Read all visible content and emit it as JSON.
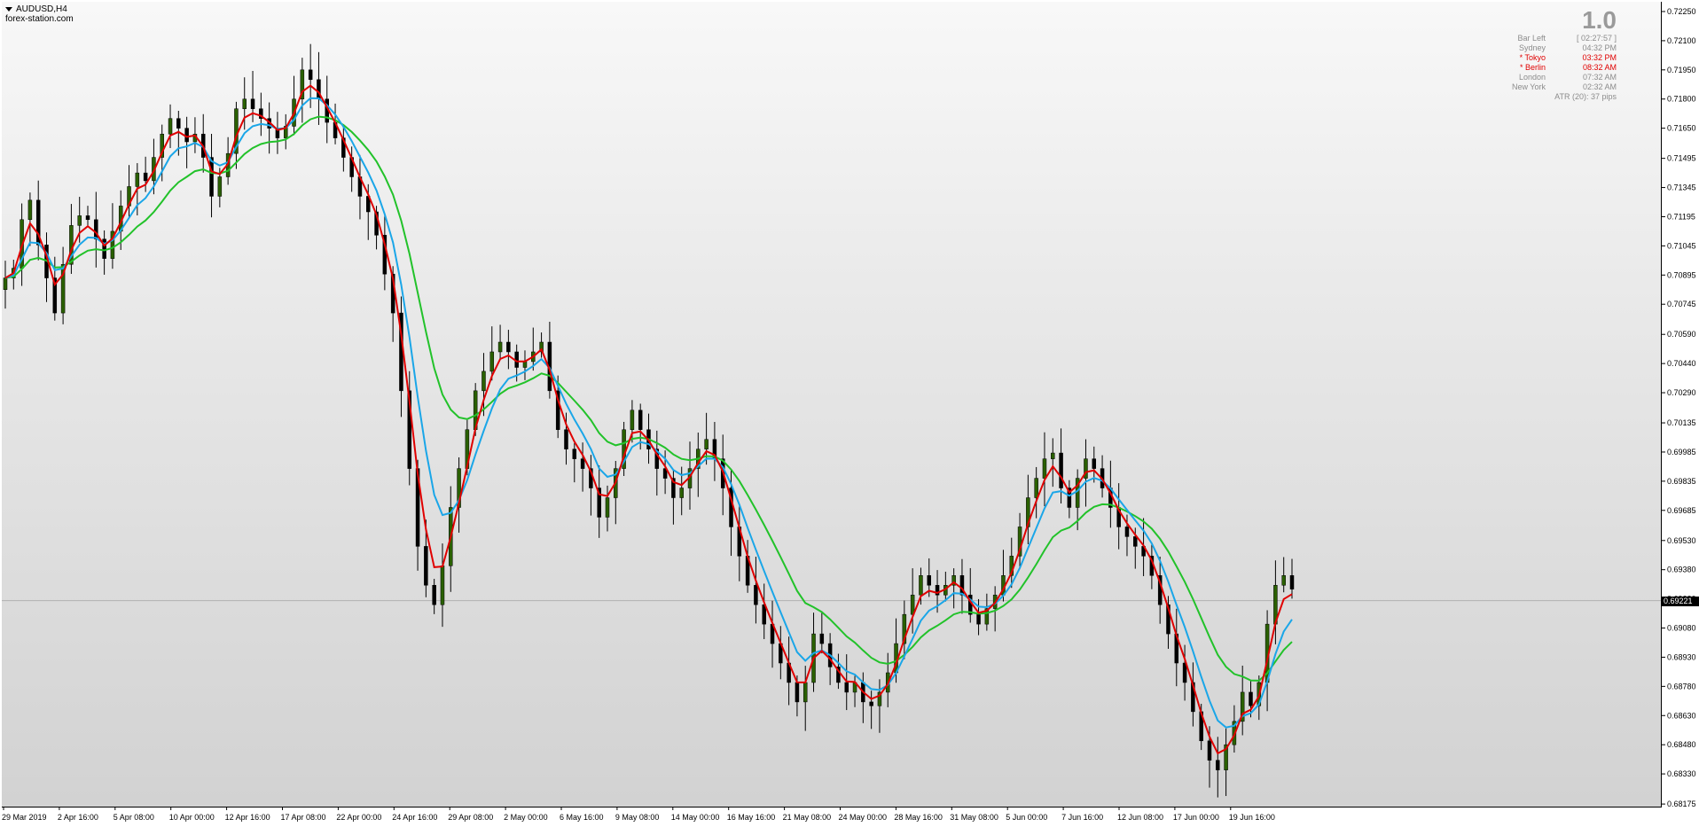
{
  "window": {
    "title": "AUDUSD,H4",
    "subtitle": "forex-station.com"
  },
  "info_panel": {
    "big_value": "1.0",
    "rows": [
      {
        "label": "Bar Left",
        "value": "[ 02:27:57 ]",
        "highlight": false
      },
      {
        "label": "Sydney",
        "value": "04:32 PM",
        "highlight": false
      },
      {
        "label": "* Tokyo",
        "value": "03:32 PM",
        "highlight": true
      },
      {
        "label": "* Berlin",
        "value": "08:32 AM",
        "highlight": true
      },
      {
        "label": "London",
        "value": "07:32 AM",
        "highlight": false
      },
      {
        "label": "New York",
        "value": "02:32 AM",
        "highlight": false
      }
    ],
    "atr": "ATR (20): 37 pips"
  },
  "current_price": "0.69221",
  "colors": {
    "bull_candle": "#2a6000",
    "bear_candle": "#000000",
    "wick": "#000000",
    "red_line": "#e00000",
    "blue_line": "#1aa6e8",
    "green_line": "#22c22a",
    "current_line": "#b0b0b0"
  },
  "chart_data": {
    "type": "line",
    "symbol": "AUDUSD",
    "timeframe": "H4",
    "ylim": [
      0.6818,
      0.7225
    ],
    "y_ticks": [
      "0.72250",
      "0.72100",
      "0.71950",
      "0.71800",
      "0.71650",
      "0.71495",
      "0.71345",
      "0.71195",
      "0.71045",
      "0.70895",
      "0.70745",
      "0.70590",
      "0.70440",
      "0.70290",
      "0.70135",
      "0.69985",
      "0.69835",
      "0.69685",
      "0.69530",
      "0.69380",
      "0.69230",
      "0.69080",
      "0.68930",
      "0.68780",
      "0.68630",
      "0.68480",
      "0.68330",
      "0.68175"
    ],
    "x_ticks": [
      "29 Mar 2019",
      "2 Apr 16:00",
      "5 Apr 08:00",
      "10 Apr 00:00",
      "12 Apr 16:00",
      "17 Apr 08:00",
      "22 Apr 00:00",
      "24 Apr 16:00",
      "29 Apr 08:00",
      "2 May 00:00",
      "6 May 16:00",
      "9 May 08:00",
      "14 May 00:00",
      "16 May 16:00",
      "21 May 08:00",
      "24 May 00:00",
      "28 May 16:00",
      "31 May 08:00",
      "5 Jun 00:00",
      "7 Jun 16:00",
      "12 Jun 08:00",
      "17 Jun 00:00",
      "19 Jun 16:00"
    ],
    "grid": false,
    "price_close": [
      0.7088,
      0.7093,
      0.7118,
      0.7128,
      0.7105,
      0.7088,
      0.707,
      0.7095,
      0.7115,
      0.712,
      0.7118,
      0.7108,
      0.7098,
      0.7112,
      0.7125,
      0.7135,
      0.7142,
      0.7138,
      0.715,
      0.7162,
      0.717,
      0.7165,
      0.7158,
      0.7162,
      0.715,
      0.713,
      0.714,
      0.7152,
      0.7175,
      0.718,
      0.7175,
      0.717,
      0.7165,
      0.716,
      0.7166,
      0.718,
      0.7195,
      0.719,
      0.718,
      0.7168,
      0.716,
      0.715,
      0.714,
      0.713,
      0.7122,
      0.711,
      0.709,
      0.707,
      0.703,
      0.699,
      0.695,
      0.693,
      0.692,
      0.694,
      0.697,
      0.699,
      0.701,
      0.703,
      0.704,
      0.705,
      0.7055,
      0.705,
      0.7042,
      0.7045,
      0.705,
      0.7055,
      0.703,
      0.701,
      0.7,
      0.6995,
      0.699,
      0.698,
      0.6965,
      0.6975,
      0.699,
      0.701,
      0.702,
      0.701,
      0.7,
      0.699,
      0.6985,
      0.6975,
      0.698,
      0.699,
      0.7,
      0.7005,
      0.6995,
      0.698,
      0.696,
      0.6945,
      0.693,
      0.692,
      0.691,
      0.69,
      0.689,
      0.688,
      0.687,
      0.688,
      0.6905,
      0.69,
      0.6888,
      0.688,
      0.6875,
      0.688,
      0.687,
      0.6868,
      0.6875,
      0.6885,
      0.69,
      0.6915,
      0.6925,
      0.6935,
      0.693,
      0.6925,
      0.693,
      0.6935,
      0.6925,
      0.6915,
      0.691,
      0.6918,
      0.6925,
      0.6935,
      0.6945,
      0.696,
      0.6975,
      0.6985,
      0.6995,
      0.6998,
      0.698,
      0.697,
      0.6985,
      0.6995,
      0.699,
      0.698,
      0.697,
      0.696,
      0.6955,
      0.695,
      0.6945,
      0.6935,
      0.692,
      0.6905,
      0.689,
      0.688,
      0.6865,
      0.685,
      0.684,
      0.6835,
      0.6848,
      0.686,
      0.6875,
      0.6868,
      0.688,
      0.691,
      0.693,
      0.6935,
      0.6928
    ]
  }
}
